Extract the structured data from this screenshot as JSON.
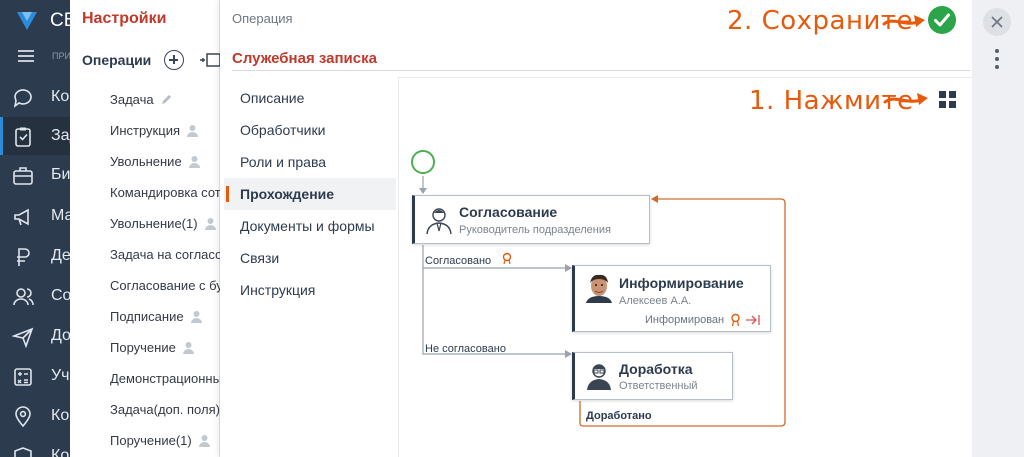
{
  "nav": {
    "brand": "СБИС",
    "section_label": "ПРИЛОЖЕНИЯ",
    "items": [
      {
        "label": "Контакты",
        "icon": "chat-icon"
      },
      {
        "label": "Задачи",
        "icon": "tasks-icon",
        "active": true
      },
      {
        "label": "Бизнес",
        "icon": "briefcase-icon"
      },
      {
        "label": "Маркетинг",
        "icon": "megaphone-icon"
      },
      {
        "label": "Деньги",
        "icon": "ruble-icon"
      },
      {
        "label": "Сотрудники",
        "icon": "people-icon"
      },
      {
        "label": "Документы",
        "icon": "send-icon"
      },
      {
        "label": "Учет",
        "icon": "calculator-icon"
      },
      {
        "label": "Компания",
        "icon": "location-icon"
      },
      {
        "label": "Контроль",
        "icon": "shield-icon"
      }
    ]
  },
  "settings": {
    "title": "Настройки",
    "ops_title": "Операции",
    "operations": [
      {
        "label": "Задача",
        "icon": "pencil-icon"
      },
      {
        "label": "Инструкция",
        "icon": "person-icon"
      },
      {
        "label": "Увольнение",
        "icon": "person-icon"
      },
      {
        "label": "Командировка сотрудника",
        "icon": ""
      },
      {
        "label": "Увольнение(1)",
        "icon": "person-icon"
      },
      {
        "label": "Задача на согласование",
        "icon": ""
      },
      {
        "label": "Согласование с бухгалтерией",
        "icon": ""
      },
      {
        "label": "Подписание",
        "icon": "person-icon"
      },
      {
        "label": "Поручение",
        "icon": "person-icon"
      },
      {
        "label": "Демонстрационный",
        "icon": ""
      },
      {
        "label": "Задача(доп. поля)",
        "icon": ""
      },
      {
        "label": "Поручение(1)",
        "icon": "person-icon"
      }
    ]
  },
  "card": {
    "breadcrumb": "Операция",
    "title": "Служебная записка",
    "save_hint": "2. Сохраните",
    "press_hint": "1. Нажмите",
    "tabs": [
      {
        "label": "Описание",
        "active": false
      },
      {
        "label": "Обработчики",
        "active": false
      },
      {
        "label": "Роли и права",
        "active": false
      },
      {
        "label": "Прохождение",
        "active": true
      },
      {
        "label": "Документы и формы",
        "active": false
      },
      {
        "label": "Связи",
        "active": false
      },
      {
        "label": "Инструкция",
        "active": false
      }
    ]
  },
  "flow": {
    "nodes": [
      {
        "name": "Согласование",
        "sub": "Руководитель подразделения"
      },
      {
        "name": "Информирование",
        "sub": "Алексеев А.А.",
        "status": "Информирован"
      },
      {
        "name": "Доработка",
        "sub": "Ответственный"
      }
    ],
    "edges": {
      "agreed": "Согласовано",
      "not_agreed": "Не согласовано",
      "reworked": "Доработано"
    }
  },
  "colors": {
    "accent_orange": "#e8590c",
    "title_red": "#c0392b",
    "nav_dark": "#2d3b4e",
    "save_green": "#2ca449",
    "start_green": "#4caf50"
  }
}
